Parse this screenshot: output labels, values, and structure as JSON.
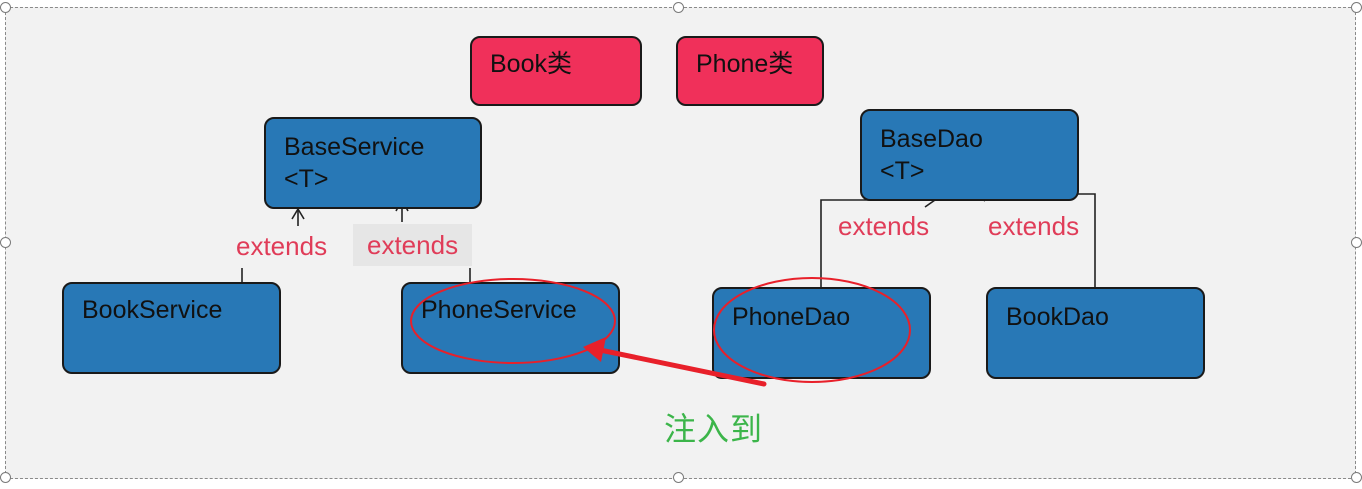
{
  "classes": {
    "book": "Book类",
    "phone": "Phone类"
  },
  "nodes": {
    "base_service": {
      "line1": "BaseService",
      "line2": "<T>"
    },
    "book_service": "BookService",
    "phone_service": "PhoneService",
    "base_dao": {
      "line1": "BaseDao",
      "line2": "<T>"
    },
    "phone_dao": "PhoneDao",
    "book_dao": "BookDao"
  },
  "relations": {
    "book_service_extends": "extends",
    "phone_service_extends": "extends",
    "phone_dao_extends": "extends",
    "book_dao_extends": "extends"
  },
  "annotation": "注入到",
  "colors": {
    "node_blue": "#2878b6",
    "class_red": "#f0305a",
    "extends_text": "#e03c58",
    "annotation_green": "#3cb54a",
    "highlight_red": "#e8202a"
  }
}
